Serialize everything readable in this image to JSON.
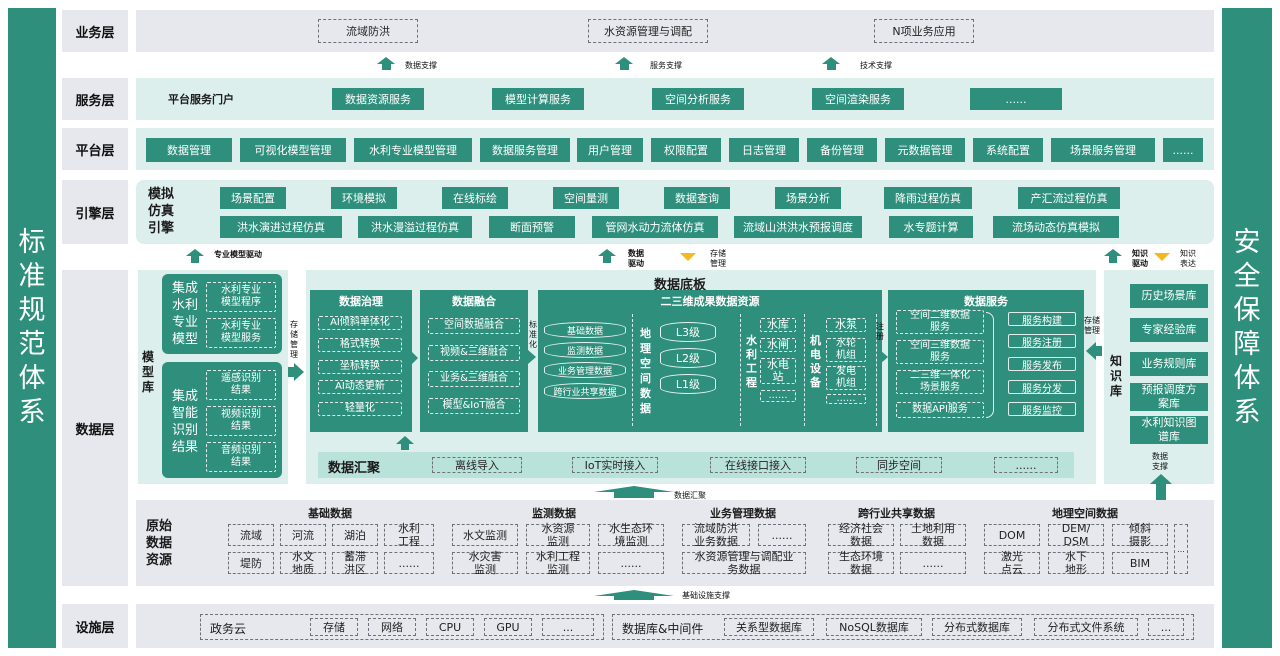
{
  "left_sidebar": {
    "text": [
      "标",
      "准",
      "规",
      "范",
      "体",
      "系"
    ]
  },
  "right_sidebar": {
    "text": [
      "安",
      "全",
      "保",
      "障",
      "体",
      "系"
    ]
  },
  "business": {
    "label": "业务层",
    "items": [
      "流域防洪",
      "水资源管理与调配",
      "N项业务应用"
    ]
  },
  "support": {
    "items": [
      "数据支撑",
      "服务支撑",
      "技术支撑"
    ]
  },
  "service": {
    "label": "服务层",
    "portal": "平台服务门户",
    "items": [
      "数据资源服务",
      "模型计算服务",
      "空间分析服务",
      "空间渲染服务",
      "......"
    ]
  },
  "platform": {
    "label": "平台层",
    "items": [
      "数据管理",
      "可视化模型管理",
      "水利专业模型管理",
      "数据服务管理",
      "用户管理",
      "权限配置",
      "日志管理",
      "备份管理",
      "元数据管理",
      "系统配置",
      "场景服务管理",
      "......"
    ]
  },
  "engine": {
    "label": "引擎层",
    "title": [
      "模拟",
      "仿真",
      "引擎"
    ],
    "row1": [
      "场景配置",
      "环境模拟",
      "在线标绘",
      "空间量测",
      "数据查询",
      "场景分析",
      "降雨过程仿真",
      "产汇流过程仿真"
    ],
    "row2": [
      "洪水演进过程仿真",
      "洪水漫溢过程仿真",
      "断面预警",
      "管网水动力流体仿真",
      "流域山洪洪水预报调度",
      "水专题计算",
      "流场动态仿真模拟"
    ]
  },
  "drivers": {
    "model": "专业模型驱动",
    "data": "数据驱动",
    "storage": "存储管理",
    "knowledge": "知识驱动",
    "knowledge_expr": "知识表达"
  },
  "data_layer": {
    "label": "数据层",
    "model_lib": {
      "title": [
        "模",
        "型",
        "库"
      ],
      "pro": {
        "title": [
          "集成",
          "水利",
          "专业",
          "模型"
        ],
        "items": [
          [
            "水利专业",
            "模型程序"
          ],
          [
            "水利专业",
            "模型服务"
          ]
        ]
      },
      "ai": {
        "title": [
          "集成",
          "智能",
          "识别",
          "结果"
        ],
        "items": [
          [
            "遥感识别",
            "结果"
          ],
          [
            "视频识别",
            "结果"
          ],
          [
            "音频识别",
            "结果"
          ]
        ]
      },
      "storage_note": [
        "存",
        "储",
        "管",
        "理"
      ]
    },
    "base_title": "数据底板",
    "governance": {
      "title": "数据治理",
      "items": [
        "AI倾斜单体化",
        "格式转换",
        "坐标转换",
        "AI动态更新",
        "轻量化"
      ]
    },
    "fusion": {
      "title": "数据融合",
      "items": [
        "空间数据融合",
        "视频&三维融合",
        "业务&三维融合",
        "模型&IoT融合"
      ]
    },
    "std_note": [
      "标",
      "准",
      "化"
    ],
    "resource": {
      "title": "二三维成果数据资源",
      "cyl_left": [
        "基础数据",
        "监测数据",
        "业务管理数据",
        "跨行业共享数据"
      ],
      "geo": {
        "title": [
          "地",
          "理",
          "空",
          "间",
          "数",
          "据"
        ],
        "levels": [
          "L3级",
          "L2级",
          "L1级"
        ]
      },
      "water": {
        "title": [
          "水",
          "利",
          "工",
          "程"
        ],
        "items": [
          "水库",
          "水闸",
          [
            "水电",
            "站"
          ],
          "......"
        ]
      },
      "elec": {
        "title": [
          "机",
          "电",
          "设",
          "备"
        ],
        "items": [
          "水泵",
          [
            "水轮",
            "机组"
          ],
          [
            "发电",
            "机组"
          ],
          "......"
        ]
      }
    },
    "register_note": [
      "注",
      "册"
    ],
    "service": {
      "title": "数据服务",
      "left": [
        [
          "空间二维数据",
          "服务"
        ],
        [
          "空间三维数据",
          "服务"
        ],
        [
          "二三维一体化",
          "场景服务"
        ],
        [
          "数据API服务"
        ]
      ],
      "right": [
        "服务构建",
        "服务注册",
        "服务发布",
        "服务分发",
        "服务监控"
      ]
    },
    "storage_note2": [
      "存储",
      "管理"
    ],
    "knowledge": {
      "title": [
        "知",
        "识",
        "库"
      ],
      "items": [
        "历史场景库",
        "专家经验库",
        "业务规则库",
        [
          "预报调度方",
          "案库"
        ],
        [
          "水利知识图",
          "谱库"
        ]
      ]
    },
    "aggregation": {
      "title": "数据汇聚",
      "items": [
        "离线导入",
        "IoT实时接入",
        "在线接口接入",
        "同步空间",
        "......"
      ]
    },
    "data_support": [
      "数据",
      "支撑"
    ],
    "agg_arrow": "数据汇聚"
  },
  "raw": {
    "title": [
      "原始",
      "数据",
      "资源"
    ],
    "groups": [
      {
        "title": "基础数据",
        "cells": [
          [
            "流域"
          ],
          [
            "河流"
          ],
          [
            "湖泊"
          ],
          [
            "水利",
            "工程"
          ],
          [
            "堤防"
          ],
          [
            "水文",
            "地质"
          ],
          [
            "蓄滞",
            "洪区"
          ],
          [
            "......"
          ]
        ]
      },
      {
        "title": "监测数据",
        "cells": [
          [
            "水文监测"
          ],
          [
            "水资源",
            "监测"
          ],
          [
            "水生态环",
            "境监测"
          ],
          [
            "水灾害",
            "监测"
          ],
          [
            "水利工程",
            "监测"
          ],
          [
            "......"
          ]
        ]
      },
      {
        "title": "业务管理数据",
        "cells": [
          [
            "流域防洪",
            "业务数据"
          ],
          [
            "......"
          ],
          [
            "水资源管理与调配业",
            "务数据"
          ]
        ]
      },
      {
        "title": "跨行业共享数据",
        "cells": [
          [
            "经济社会",
            "数据"
          ],
          [
            "土地利用",
            "数据"
          ],
          [
            "生态环境",
            "数据"
          ],
          [
            "......"
          ]
        ]
      },
      {
        "title": "地理空间数据",
        "cells": [
          [
            "DOM"
          ],
          [
            "DEM/",
            "DSM"
          ],
          [
            "倾斜",
            "摄影"
          ],
          [
            "激光",
            "点云"
          ],
          [
            "水下",
            "地形"
          ],
          [
            "BIM"
          ],
          [
            "..."
          ]
        ]
      }
    ]
  },
  "infra_arrow": "基础设施支撑",
  "infra": {
    "label": "设施层",
    "cloud": "政务云",
    "cloud_items": [
      "存储",
      "网络",
      "CPU",
      "GPU",
      "..."
    ],
    "db": "数据库&中间件",
    "db_items": [
      "关系型数据库",
      "NoSQL数据库",
      "分布式数据库",
      "分布式文件系统",
      "..."
    ]
  }
}
